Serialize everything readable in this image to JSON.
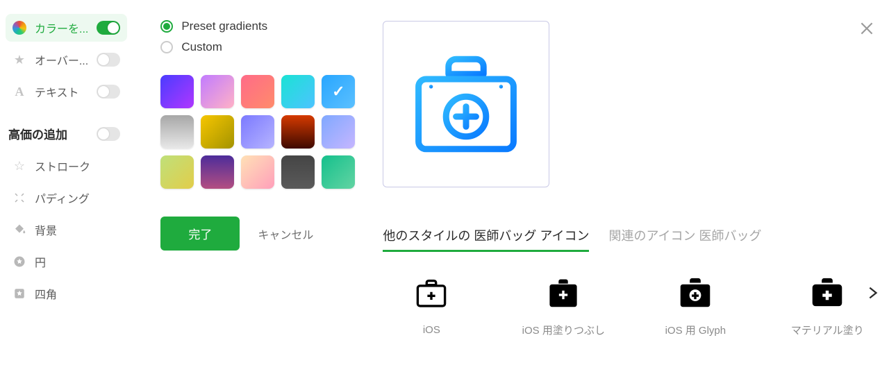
{
  "sidebar": {
    "items": [
      {
        "label": "カラーを...",
        "toggled": true
      },
      {
        "label": "オーバー...",
        "toggled": false
      },
      {
        "label": "テキスト",
        "toggled": false
      }
    ],
    "section_heading": "高価の追加",
    "section_items": [
      {
        "label": "ストローク"
      },
      {
        "label": "パディング"
      },
      {
        "label": "背景"
      },
      {
        "label": "円"
      },
      {
        "label": "四角"
      }
    ]
  },
  "gradient_panel": {
    "radio_preset": "Preset gradients",
    "radio_custom": "Custom",
    "selected_mode": "preset",
    "selected_swatch_index": 4,
    "done": "完了",
    "cancel": "キャンセル"
  },
  "right_panel": {
    "tab_other_styles": "他のスタイルの 医師バッグ アイコン",
    "tab_related": "関連のアイコン 医師バッグ",
    "styles": [
      {
        "label": "iOS",
        "variant": "outline"
      },
      {
        "label": "iOS 用塗りつぶし",
        "variant": "filled"
      },
      {
        "label": "iOS 用 Glyph",
        "variant": "glyph"
      },
      {
        "label": "マテリアル塗り",
        "variant": "material"
      }
    ]
  }
}
